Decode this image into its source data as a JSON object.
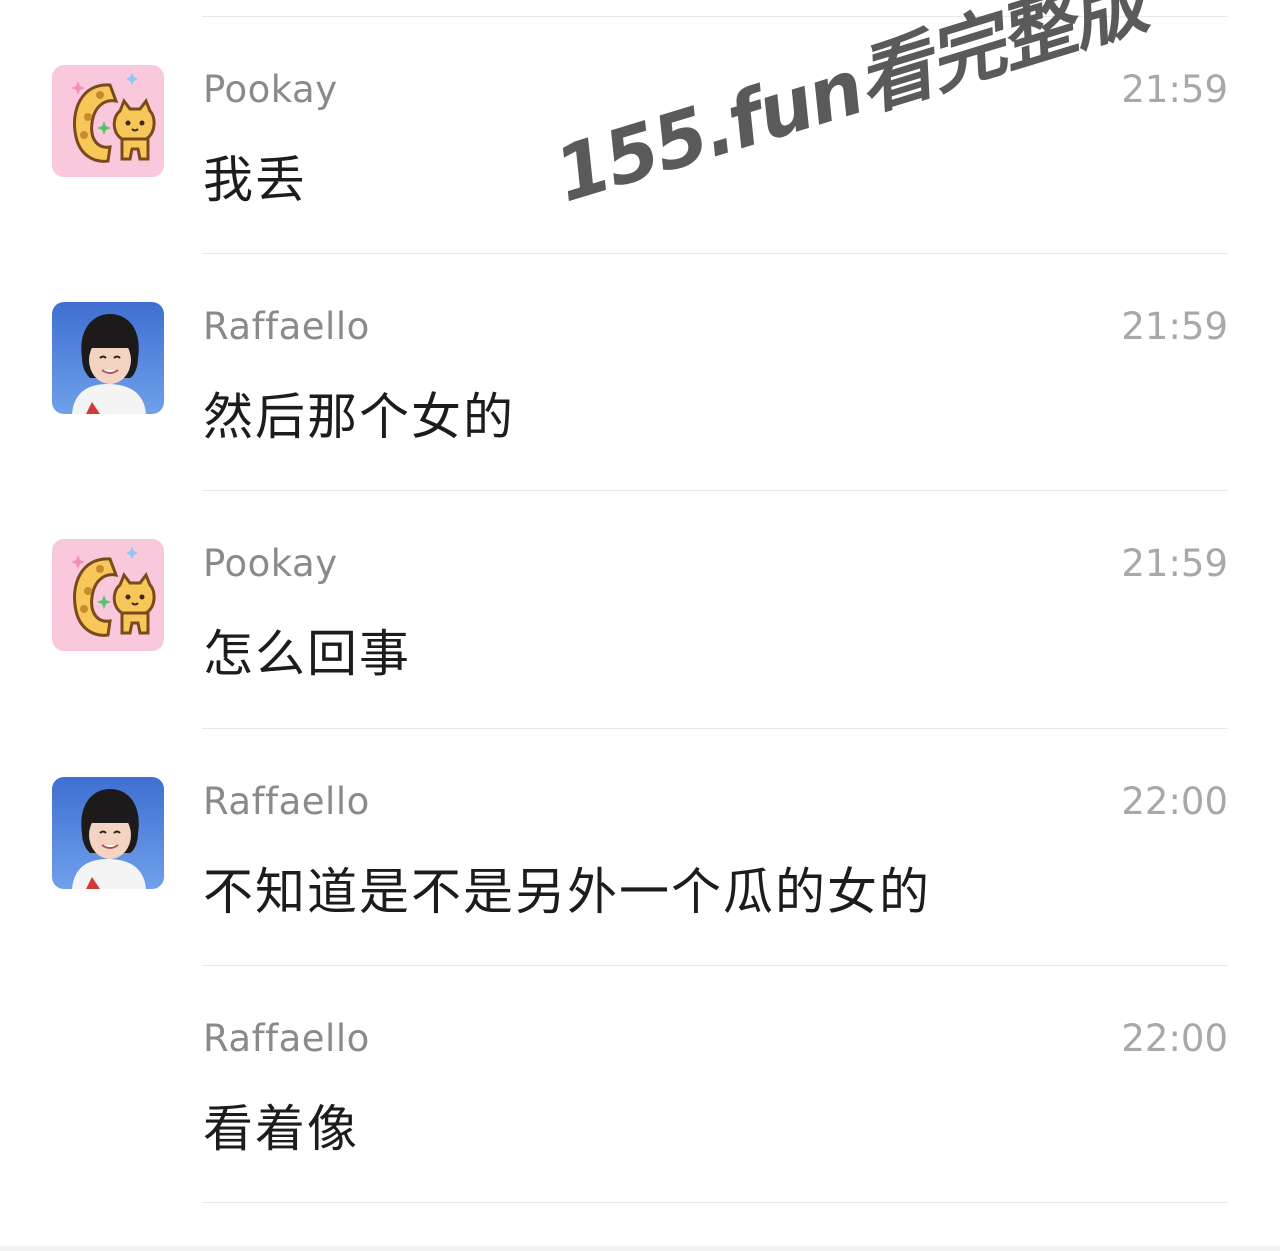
{
  "watermark": "155.fun看完整版",
  "messages": [
    {
      "sender": "Pookay",
      "time": "21:59",
      "text": "我丢",
      "avatar": "cat-avatar"
    },
    {
      "sender": "Raffaello",
      "time": "21:59",
      "text": "然后那个女的",
      "avatar": "girl-avatar"
    },
    {
      "sender": "Pookay",
      "time": "21:59",
      "text": "怎么回事",
      "avatar": "cat-avatar"
    },
    {
      "sender": "Raffaello",
      "time": "22:00",
      "text": "不知道是不是另外一个瓜的女的",
      "avatar": "girl-avatar"
    },
    {
      "sender": "Raffaello",
      "time": "22:00",
      "text": "看着像",
      "avatar": "none"
    }
  ],
  "colors": {
    "background": "#ffffff",
    "sender": "#8a8a8a",
    "time": "#a8a8a8",
    "text": "#1c1c1c",
    "divider": "#e8e8e8",
    "cat_avatar_bg": "#f9c8dc",
    "girl_avatar_bg": "#4a78d6"
  }
}
